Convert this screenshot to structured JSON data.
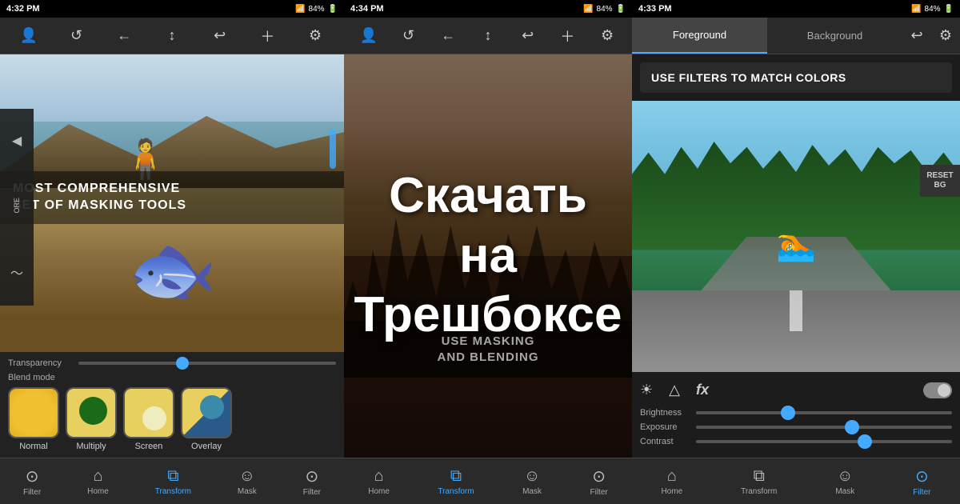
{
  "panels": {
    "left": {
      "time": "4:32 PM",
      "battery": "84%",
      "toolbar_icons": [
        "person",
        "rotate-left",
        "arrow-left",
        "arrow-up",
        "undo",
        "plus",
        "gear"
      ],
      "masking_text_line1": "MOST COMPREHENSIVE",
      "masking_text_line2": "SET OF MASKING TOOLS",
      "transparency_label": "Transparency",
      "blend_mode_label": "Blend mode",
      "blend_modes": [
        {
          "label": "Normal",
          "type": "normal"
        },
        {
          "label": "Multiply",
          "type": "multiply"
        },
        {
          "label": "Screen",
          "type": "screen"
        },
        {
          "label": "Overlay",
          "type": "overlay"
        }
      ],
      "nav_items": [
        {
          "label": "Filter",
          "icon": "⊙",
          "active": false
        },
        {
          "label": "Home",
          "icon": "⌂",
          "active": false
        },
        {
          "label": "Transform",
          "icon": "⧉",
          "active": true
        },
        {
          "label": "Mask",
          "icon": "☺",
          "active": false
        },
        {
          "label": "Filter",
          "icon": "⊙",
          "active": false
        }
      ]
    },
    "middle": {
      "time": "4:34 PM",
      "battery": "84%",
      "toolbar_icons": [
        "person",
        "rotate-left",
        "arrow-left",
        "arrow-up",
        "undo",
        "plus",
        "gear"
      ],
      "overlay_text_line1": "USE MASKING",
      "overlay_text_line2": "AND BLENDING",
      "russian_line1": "Скачать",
      "russian_line2": "на Трешбоксе",
      "nav_items": [
        {
          "label": "Home",
          "icon": "⌂",
          "active": false
        },
        {
          "label": "Transform",
          "icon": "⧉",
          "active": true
        },
        {
          "label": "Mask",
          "icon": "☺",
          "active": false
        },
        {
          "label": "Filter",
          "icon": "⊙",
          "active": false
        }
      ]
    },
    "right": {
      "time": "4:33 PM",
      "battery": "84%",
      "tab_foreground": "Foreground",
      "tab_background": "Background",
      "filter_hint": "USE FILTERS TO MATCH COLORS",
      "reset_bg_label": "RESET BG",
      "brightness_label": "Brightness",
      "exposure_label": "Exposure",
      "contrast_label": "Contrast",
      "brightness_value": 35,
      "exposure_value": 60,
      "contrast_value": 65,
      "nav_items": [
        {
          "label": "Home",
          "icon": "⌂",
          "active": false
        },
        {
          "label": "Transform",
          "icon": "⧉",
          "active": false
        },
        {
          "label": "Mask",
          "icon": "☺",
          "active": false
        },
        {
          "label": "Filter",
          "icon": "⊙",
          "active": true
        }
      ]
    }
  }
}
